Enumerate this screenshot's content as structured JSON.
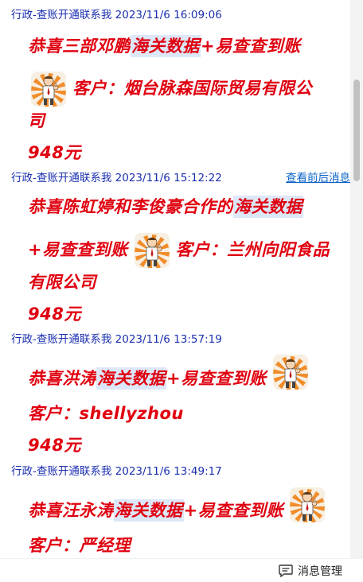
{
  "messages": [
    {
      "header": "行政-查账开通联系我 2023/11/6 16:09:06",
      "lines": [
        {
          "pre": "恭喜三部邓鹏",
          "hl": "海关数据",
          "post": "+易查查到账"
        },
        {
          "pre": "",
          "emoji": "thumbs-up-man",
          "post": "客户：烟台脉森国际贸易有限公"
        },
        {
          "pre": "司"
        },
        {
          "pre": "948元"
        }
      ]
    },
    {
      "header": "行政-查账开通联系我 2023/11/6 15:12:22",
      "link": "查看前后消息",
      "lines": [
        {
          "pre": "恭喜陈虹婷和李俊豪合作的",
          "hl": "海关数据",
          "post": ""
        },
        {
          "pre": "+易查查到账",
          "emoji": "thumbs-up-man",
          "post": "客户：兰州向阳食品"
        },
        {
          "pre": "有限公司"
        },
        {
          "pre": "948元"
        }
      ]
    },
    {
      "header": "行政-查账开通联系我 2023/11/6 13:57:19",
      "lines": [
        {
          "pre": "恭喜洪涛",
          "hl": "海关数据",
          "post": "+易查查到账",
          "emoji_after": "thumbs-up-man"
        },
        {
          "pre": "客户：shellyzhou"
        },
        {
          "pre": "948元"
        }
      ]
    },
    {
      "header": "行政-查账开通联系我 2023/11/6 13:49:17",
      "lines": [
        {
          "pre": "恭喜汪永涛",
          "hl": "海关数据",
          "post": "+易查查到账",
          "emoji_after": "thumbs-up-man"
        },
        {
          "pre": "客户：严经理"
        }
      ]
    }
  ],
  "bottom_bar": {
    "manage_label": "消息管理",
    "icon": "message-icon"
  },
  "colors": {
    "header": "#1a2fb0",
    "message_text": "#e00010",
    "highlight": "#dce7f7",
    "link": "#0a63c8"
  }
}
